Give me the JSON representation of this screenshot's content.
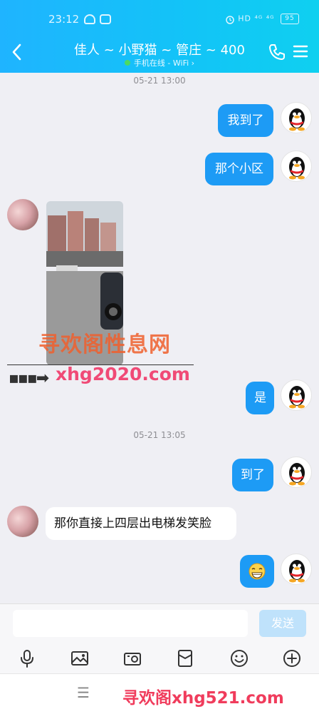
{
  "status": {
    "time": "23:12",
    "right_text": "HD ⁴ᴳ ⁴ᴳ",
    "battery": "95"
  },
  "header": {
    "title": "佳人 ~ 小野猫 ~ 管庄 ~ 400",
    "subtitle": "手机在线 - WiFi ›"
  },
  "timestamps": [
    "05-21 13:00",
    "05-21 13:05"
  ],
  "messages": {
    "m1": "我到了",
    "m2": "那个小区",
    "m3": "是",
    "m4": "到了",
    "m5": "那你直接上四层出电梯发笑脸",
    "m6": "😁"
  },
  "watermark": {
    "cn": "寻欢阁性息网",
    "url": "xhg2020.com",
    "bottom": "寻欢阁xhg521.com"
  },
  "composer": {
    "send_label": "发送"
  },
  "nav": {
    "menu_glyph": "☰"
  },
  "colors": {
    "header": "#1fb4ff",
    "bubble_me": "#1d9bf5",
    "send_disabled": "#bfe2fb"
  }
}
